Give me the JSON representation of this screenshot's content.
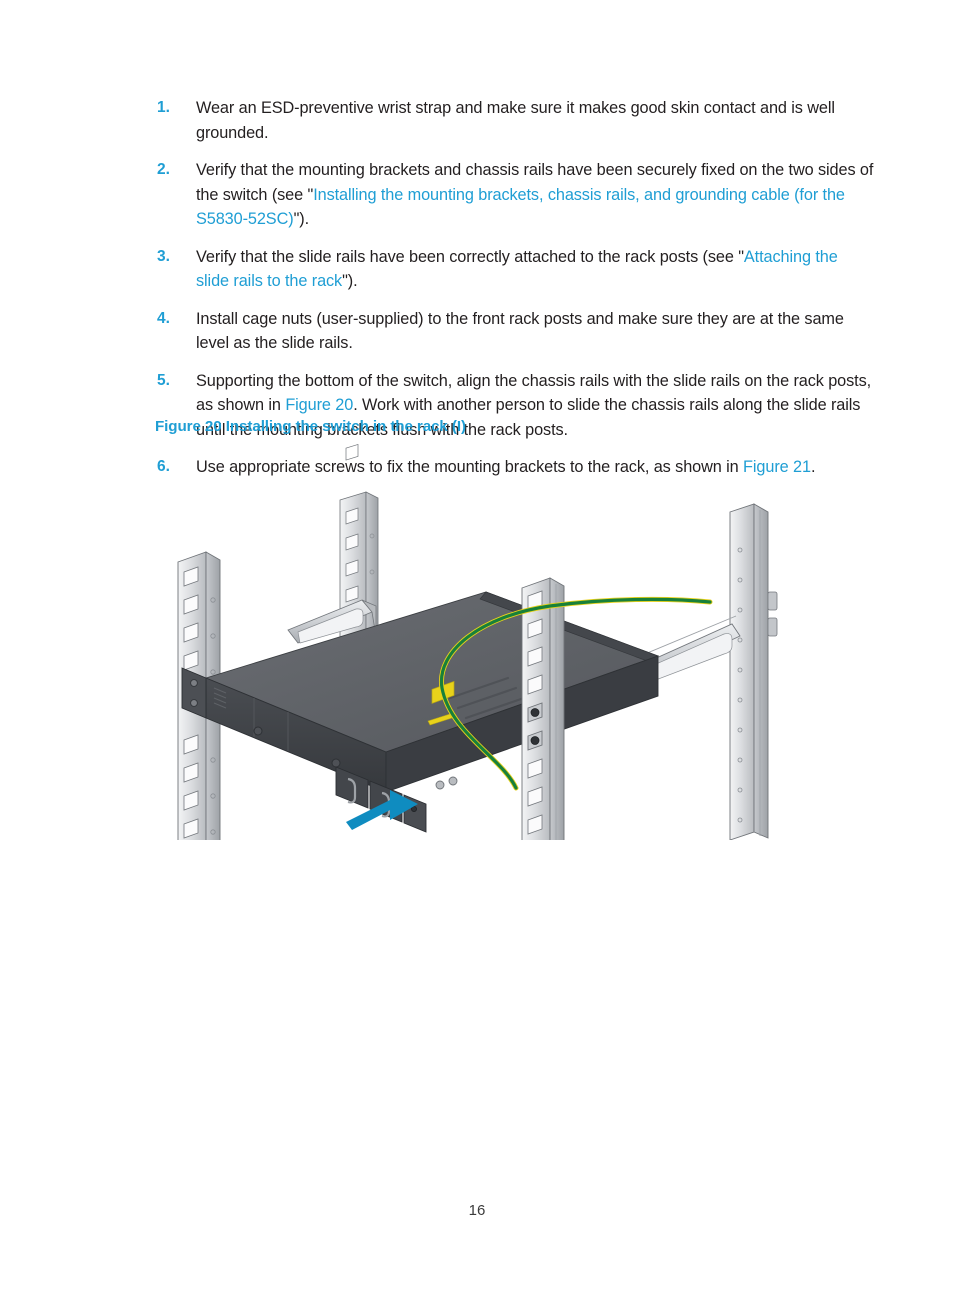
{
  "document": {
    "page_number": "16",
    "accent_color": "#1f9ed4",
    "body_color": "#231f20"
  },
  "procedure": {
    "items": [
      {
        "number": "1.",
        "segments": [
          {
            "text": "Wear an ESD-preventive wrist strap and make sure it makes good skin contact and is well grounded.",
            "link": false
          }
        ]
      },
      {
        "number": "2.",
        "segments": [
          {
            "text": "Verify that the mounting brackets and chassis rails have been securely fixed on the two sides of the switch (see \"",
            "link": false
          },
          {
            "text": "Installing the mounting brackets, chassis rails, and grounding cable (for the S5830-52SC)",
            "link": true
          },
          {
            "text": "\").",
            "link": false
          }
        ]
      },
      {
        "number": "3.",
        "segments": [
          {
            "text": "Verify that the slide rails have been correctly attached to the rack posts (see \"",
            "link": false
          },
          {
            "text": "Attaching the slide rails to the rack",
            "link": true
          },
          {
            "text": "\").",
            "link": false
          }
        ]
      },
      {
        "number": "4.",
        "segments": [
          {
            "text": "Install cage nuts (user-supplied) to the front rack posts and make sure they are at the same level as the slide rails.",
            "link": false
          }
        ]
      },
      {
        "number": "5.",
        "segments": [
          {
            "text": "Supporting the bottom of the switch, align the chassis rails with the slide rails on the rack posts, as shown in ",
            "link": false
          },
          {
            "text": "Figure 20",
            "link": true
          },
          {
            "text": ". Work with another person to slide the chassis rails along the slide rails until the mounting brackets flush with the rack posts.",
            "link": false
          }
        ]
      },
      {
        "number": "6.",
        "segments": [
          {
            "text": "Use appropriate screws to fix the mounting brackets to the rack, as shown in ",
            "link": false
          },
          {
            "text": "Figure 21",
            "link": true
          },
          {
            "text": ".",
            "link": false
          }
        ]
      }
    ]
  },
  "figure": {
    "caption": "Figure 20 Installing the switch in the rack (I)",
    "illustration": {
      "name": "rack-installation-diagram",
      "description": "Isometric line drawing of a 1U switch being slid into a four-post rack",
      "components": [
        "front-left-rack-post",
        "front-right-rack-post",
        "rear-left-rack-post",
        "rear-right-rack-post",
        "slide-rail-left",
        "slide-rail-right",
        "switch-chassis",
        "mounting-bracket-left",
        "grounding-cable",
        "direction-arrow",
        "power-supply-module-1",
        "power-supply-module-2"
      ],
      "colors": {
        "arrow": "#0f8cc0",
        "chassis_top": "#5e6166",
        "chassis_front": "#3f4246",
        "rack_metal": "#d7d9dc",
        "grounding_cable_green": "#18803a",
        "grounding_cable_yellow": "#e8d21a",
        "label_yellow": "#e8d21a"
      }
    }
  }
}
